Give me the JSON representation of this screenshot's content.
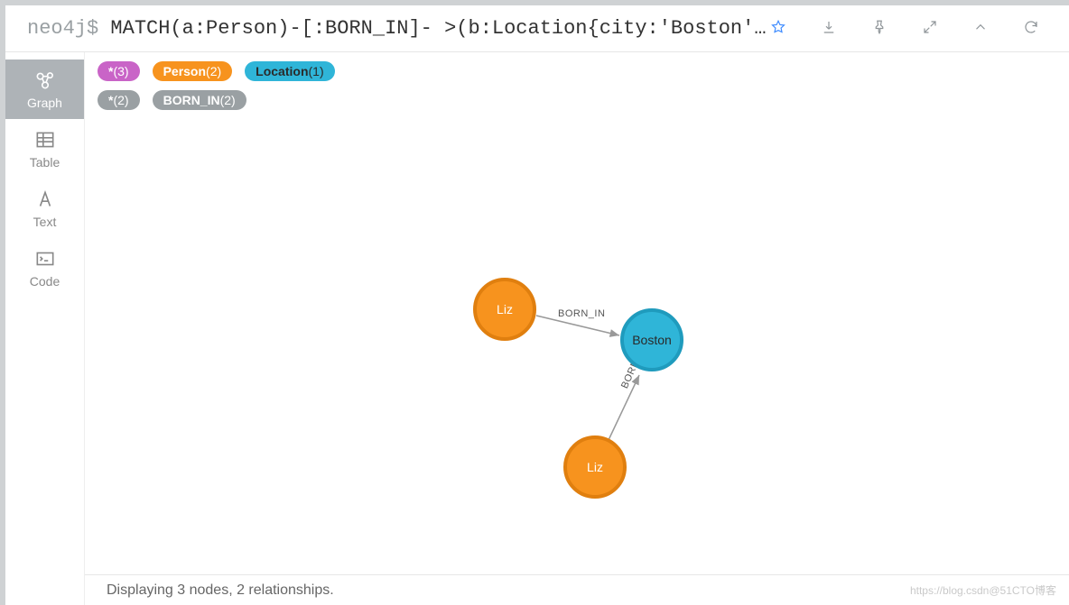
{
  "prompt": {
    "label": "neo4j$",
    "query": "MATCH(a:Person)-[:BORN_IN]- >(b:Location{city:'Boston'…"
  },
  "sidebar": {
    "items": [
      {
        "label": "Graph"
      },
      {
        "label": "Table"
      },
      {
        "label": "Text"
      },
      {
        "label": "Code"
      }
    ]
  },
  "chips": {
    "nodes": [
      {
        "label": "*",
        "count": "(3)"
      },
      {
        "label": "Person",
        "count": "(2)"
      },
      {
        "label": "Location",
        "count": "(1)"
      }
    ],
    "rels": [
      {
        "label": "*",
        "count": "(2)"
      },
      {
        "label": "BORN_IN",
        "count": "(2)"
      }
    ]
  },
  "graph": {
    "nodes": [
      {
        "id": "liz1",
        "label": "Liz",
        "type": "Person"
      },
      {
        "id": "boston",
        "label": "Boston",
        "type": "Location"
      },
      {
        "id": "liz2",
        "label": "Liz",
        "type": "Person"
      }
    ],
    "edges": [
      {
        "from": "liz1",
        "to": "boston",
        "label": "BORN_IN"
      },
      {
        "from": "liz2",
        "to": "boston",
        "label": "BORN_IN"
      }
    ]
  },
  "footer": {
    "status": "Displaying 3 nodes, 2 relationships."
  },
  "watermark": "https://blog.csdn@51CTO博客"
}
